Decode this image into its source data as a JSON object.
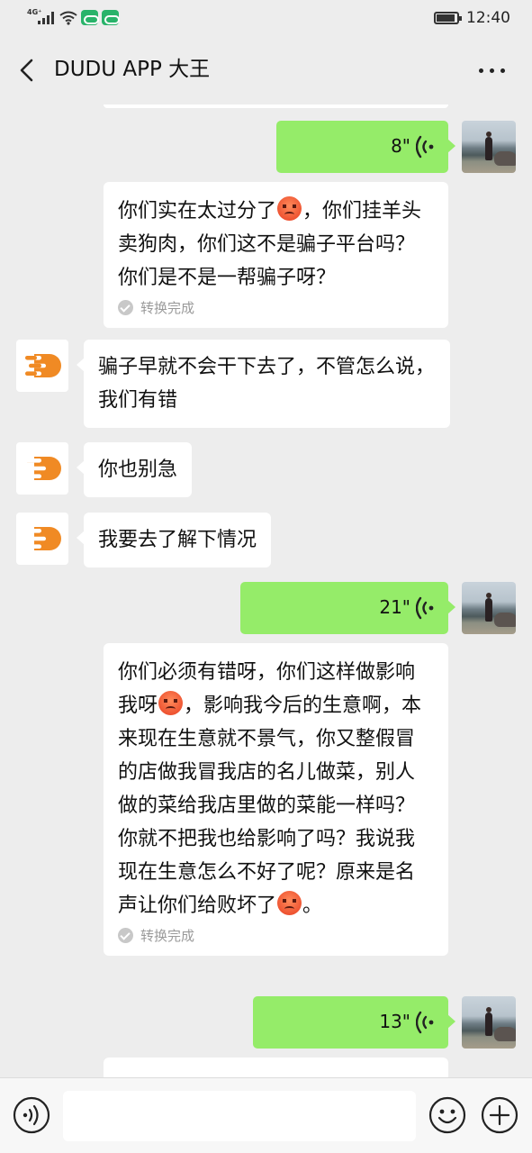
{
  "status_bar": {
    "network": "4G⁺",
    "time": "12:40",
    "icons": [
      "signal-icon",
      "wifi-icon",
      "app-notification-icon",
      "app-notification-icon",
      "battery-icon"
    ]
  },
  "header": {
    "title": "DUDU APP 大王",
    "back_icon": "chevron-left-icon",
    "more_icon": "more-dots-icon"
  },
  "messages": [
    {
      "type": "voice",
      "side": "right",
      "duration": "8\"",
      "transcript_parts": [
        "你们实在太过分了",
        "，你们挂羊头卖狗肉，你们这不是骗子平台吗？你们是不是一帮骗子呀？"
      ],
      "status": "转换完成"
    },
    {
      "type": "text",
      "side": "left",
      "text": "骗子早就不会干下去了，不管怎么说，我们有错"
    },
    {
      "type": "text",
      "side": "left",
      "text": "你也别急"
    },
    {
      "type": "text",
      "side": "left",
      "text": "我要去了解下情况"
    },
    {
      "type": "voice",
      "side": "right",
      "duration": "21\"",
      "transcript_parts": [
        "你们必须有错呀，你们这样做影响我呀",
        "，影响我今后的生意啊，本来现在生意就不景气，你又整假冒的店做我冒我店的名儿做菜，别人做的菜给我店里做的菜能一样吗？你就不把我也给影响了吗？我说我现在生意怎么不好了呢？原来是名声让你们给败坏了",
        "。"
      ],
      "status": "转换完成"
    },
    {
      "type": "voice",
      "side": "right",
      "duration": "13\""
    }
  ],
  "input_bar": {
    "placeholder": "",
    "voice_icon": "voice-input-icon",
    "emoji_icon": "emoji-icon",
    "plus_icon": "plus-icon"
  }
}
